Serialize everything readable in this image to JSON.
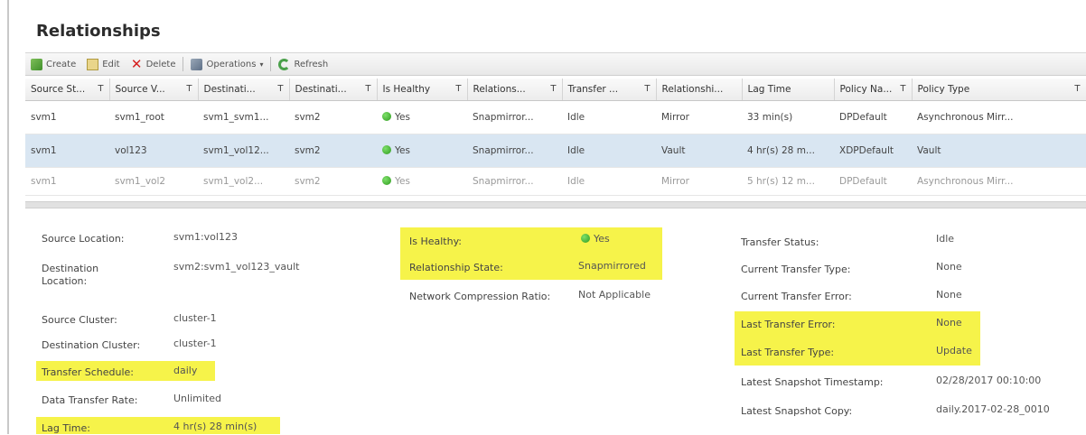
{
  "title": "Relationships",
  "toolbar": {
    "create": "Create",
    "edit": "Edit",
    "delete": "Delete",
    "operations": "Operations",
    "operations_caret": "▾",
    "refresh": "Refresh"
  },
  "grid": {
    "columns": [
      "Source St...",
      "Source V...",
      "Destinati...",
      "Destinati...",
      "Is Healthy",
      "Relations...",
      "Transfer ...",
      "Relationshi...",
      "Lag Time",
      "Policy Na...",
      "Policy Type"
    ],
    "filter_icon": "T",
    "rows": [
      [
        "svm1",
        "svm1_root",
        "svm1_svm1...",
        "svm2",
        "Yes",
        "Snapmirror...",
        "Idle",
        "Mirror",
        "33 min(s)",
        "DPDefault",
        "Asynchronous Mirr..."
      ],
      [
        "svm1",
        "vol123",
        "svm1_vol12...",
        "svm2",
        "Yes",
        "Snapmirror...",
        "Idle",
        "Vault",
        "4 hr(s) 28 m...",
        "XDPDefault",
        "Vault"
      ],
      [
        "svm1",
        "svm1_vol2",
        "svm1_vol2...",
        "svm2",
        "Yes",
        "Snapmirror...",
        "Idle",
        "Mirror",
        "5 hr(s) 12 m...",
        "DPDefault",
        "Asynchronous Mirr..."
      ]
    ]
  },
  "details": {
    "col1": [
      {
        "label": "Source Location:",
        "value": "svm1:vol123"
      },
      {
        "label": "Destination Location:",
        "value": "svm2:svm1_vol123_vault"
      },
      {
        "label": "Source Cluster:",
        "value": "cluster-1"
      },
      {
        "label": "Destination Cluster:",
        "value": "cluster-1"
      },
      {
        "label": "Transfer Schedule:",
        "value": "daily"
      },
      {
        "label": "Data Transfer Rate:",
        "value": "Unlimited"
      },
      {
        "label": "Lag Time:",
        "value": "4 hr(s) 28 min(s)"
      }
    ],
    "col2": [
      {
        "label": "Is Healthy:",
        "value": "Yes"
      },
      {
        "label": "Relationship State:",
        "value": "Snapmirrored"
      },
      {
        "label": "Network Compression Ratio:",
        "value": "Not Applicable"
      }
    ],
    "col3": [
      {
        "label": "Transfer Status:",
        "value": "Idle"
      },
      {
        "label": "Current Transfer Type:",
        "value": "None"
      },
      {
        "label": "Current Transfer Error:",
        "value": "None"
      },
      {
        "label": "Last Transfer Error:",
        "value": "None"
      },
      {
        "label": "Last Transfer Type:",
        "value": "Update"
      },
      {
        "label": "Latest Snapshot Timestamp:",
        "value": "02/28/2017 00:10:00"
      },
      {
        "label": "Latest Snapshot Copy:",
        "value": "daily.2017-02-28_0010"
      }
    ]
  },
  "colors": {
    "highlight": "#f6f34a",
    "selected_row": "#d9e6f2",
    "healthy": "#3cb52a"
  }
}
